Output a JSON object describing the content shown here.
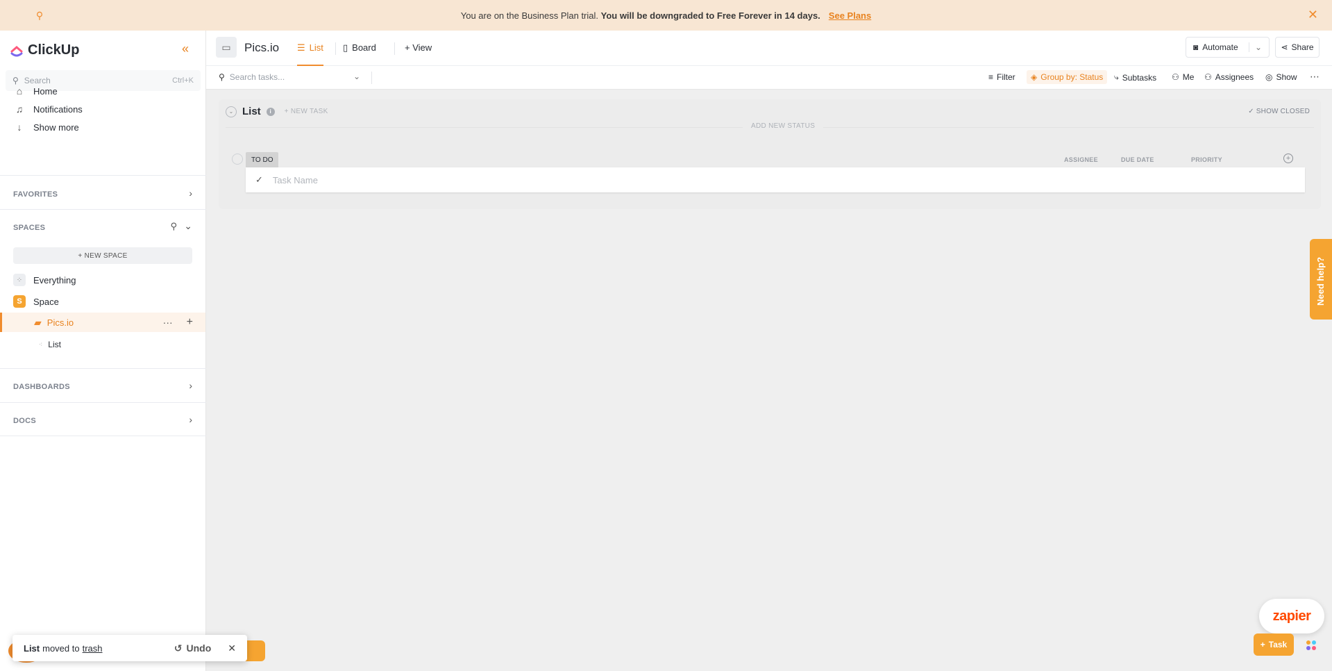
{
  "banner": {
    "message_prefix": "You are on the Business Plan trial. ",
    "message_bold": "You will be downgraded to Free Forever in 14 days.",
    "link": "See Plans"
  },
  "sidebar": {
    "logo": "ClickUp",
    "search": {
      "placeholder": "Search",
      "shortcut": "Ctrl+K"
    },
    "nav": [
      {
        "label": "Home"
      },
      {
        "label": "Notifications"
      },
      {
        "label": "Show more"
      }
    ],
    "favorites_title": "FAVORITES",
    "spaces_title": "SPACES",
    "new_space": "+ NEW SPACE",
    "everything": "Everything",
    "space": {
      "badge": "S",
      "label": "Space"
    },
    "folder": "Pics.io",
    "list": "List",
    "dashboards_title": "DASHBOARDS",
    "docs_title": "DOCS"
  },
  "toast": {
    "bold": "List",
    "text": "moved to",
    "link": "trash",
    "undo": "Undo"
  },
  "header": {
    "title": "Pics.io",
    "tabs": [
      {
        "label": "List"
      },
      {
        "label": "Board"
      },
      {
        "label": "+ View"
      }
    ],
    "automate": "Automate",
    "share": "Share"
  },
  "toolbar": {
    "search_placeholder": "Search tasks...",
    "filter": "Filter",
    "group_by": "Group by: Status",
    "subtasks": "Subtasks",
    "me": "Me",
    "assignees": "Assignees",
    "show": "Show"
  },
  "list": {
    "name": "List",
    "new_task": "+ NEW TASK",
    "show_closed": "✓ SHOW CLOSED",
    "add_new_status": "ADD NEW STATUS",
    "status": "TO DO",
    "columns": [
      "ASSIGNEE",
      "DUE DATE",
      "PRIORITY"
    ],
    "task_placeholder": "Task Name"
  },
  "widgets": {
    "need_help": "Need help?",
    "zapier": "zapier",
    "task_button": "Task"
  },
  "colors": {
    "accent": "#f08c2e",
    "accent_light": "#f5a431",
    "banner_bg": "#f8e6d3",
    "zapier": "#ff4a00"
  }
}
